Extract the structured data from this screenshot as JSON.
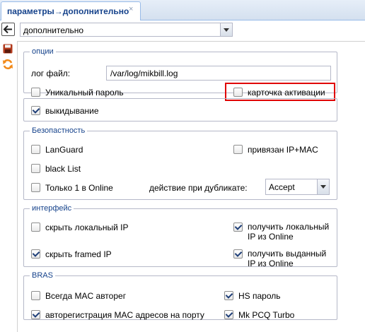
{
  "tab": {
    "title": "параметры→дополнительно"
  },
  "header": {
    "section_select_value": "дополнительно"
  },
  "options": {
    "legend": "опции",
    "log_file_label": "лог файл:",
    "log_file_value": "/var/log/mikbill.log",
    "unique_password": {
      "label": "Уникальный пароль",
      "checked": false
    },
    "activation_card": {
      "label": "карточка активации",
      "checked": false
    }
  },
  "kickout": {
    "label": "выкидывание",
    "checked": true
  },
  "security": {
    "legend": "Безопастность",
    "languard": {
      "label": "LanGuard",
      "checked": false
    },
    "ip_mac": {
      "label": "привязан IP+MAC",
      "checked": false
    },
    "black_list": {
      "label": "black List",
      "checked": false
    },
    "only_one_online": {
      "label": "Только 1 в Online",
      "checked": false
    },
    "duplicate_action_label": "действие при дубликате:",
    "duplicate_action_value": "Accept"
  },
  "interface": {
    "legend": "интерфейс",
    "hide_local_ip": {
      "label": "скрыть локальный IP",
      "checked": false
    },
    "get_local_ip": {
      "label": "получить локальный IP из Online",
      "checked": true
    },
    "hide_framed_ip": {
      "label": "скрыть framed IP",
      "checked": true
    },
    "get_assigned_ip": {
      "label": "получить выданный IP из Online",
      "checked": true
    }
  },
  "bras": {
    "legend": "BRAS",
    "always_mac_autoreg": {
      "label": "Всегда MAC авторег",
      "checked": false
    },
    "hs_password": {
      "label": "HS пароль",
      "checked": true
    },
    "mac_autoreg_port": {
      "label": "авторегистрация MAC адресов на порту",
      "checked": true
    },
    "mk_pcq_turbo": {
      "label": "Mk PCQ Turbo",
      "checked": true
    }
  },
  "colors": {
    "highlight_box": "#e00000",
    "save_icon": "#b23a1c",
    "refresh_icon": "#f28a1a",
    "legend_text": "#15428b"
  },
  "icons": [
    "close-icon",
    "back-arrow-icon",
    "save-icon",
    "refresh-icon",
    "chevron-down-icon",
    "checkmark-icon"
  ]
}
